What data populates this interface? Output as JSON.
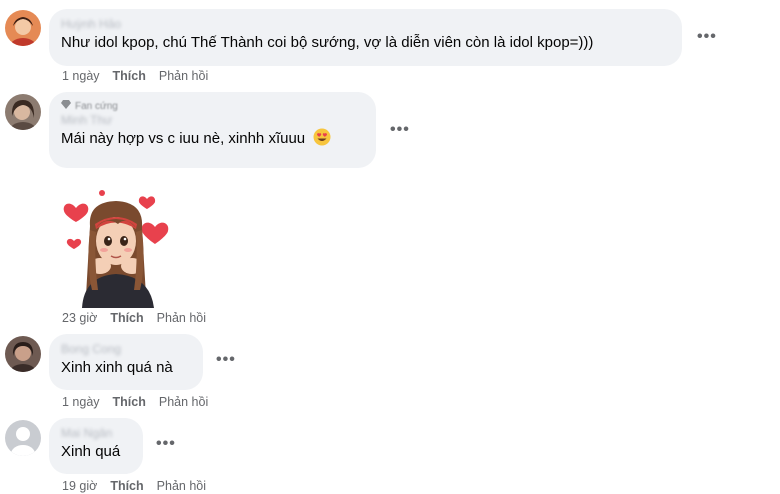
{
  "comments": [
    {
      "author": "Huỳnh Hảo",
      "text": "Như idol kpop, chú Thế Thành coi bộ sướng, vợ là diễn viên còn là idol kpop=)))",
      "time": "1 ngày",
      "like": "Thích",
      "reply": "Phản hồi"
    },
    {
      "badge": "Fan cứng",
      "author": "Minh Thư",
      "text": "Mái này hợp vs c iuu nè, xinhh xĩuuu",
      "emoji": "heart-eyes-emoji",
      "time": "23 giờ",
      "like": "Thích",
      "reply": "Phản hồi",
      "sticker": "girl-with-hearts-sticker"
    },
    {
      "author": "Bong Cong",
      "text": "Xinh xinh quá nà",
      "time": "1 ngày",
      "like": "Thích",
      "reply": "Phản hồi"
    },
    {
      "author": "Mai Ngân",
      "text": "Xinh quá",
      "time": "19 giờ",
      "like": "Thích",
      "reply": "Phản hồi"
    }
  ],
  "more_icon": "•••",
  "colors": {
    "bubble": "#f0f2f5",
    "meta": "#65676b",
    "heart": "#e8414d"
  }
}
